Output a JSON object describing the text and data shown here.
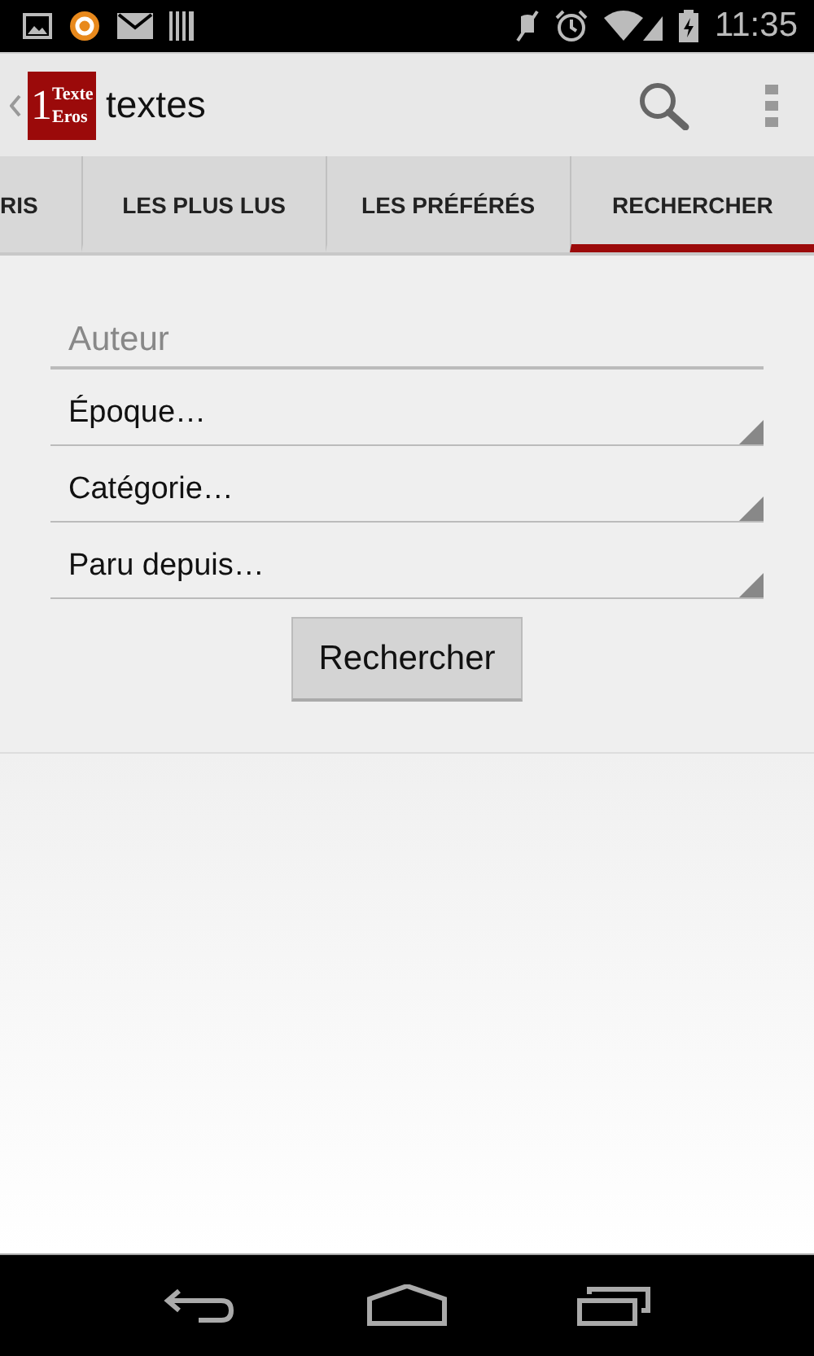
{
  "status_bar": {
    "time": "11:35"
  },
  "action_bar": {
    "logo": {
      "number": "1",
      "line_1": "Texte",
      "line_2": "Eros"
    },
    "title": "textes"
  },
  "tabs": [
    {
      "label": "RIS",
      "selected": false
    },
    {
      "label": "LES PLUS LUS",
      "selected": false
    },
    {
      "label": "LES PRÉFÉRÉS",
      "selected": false
    },
    {
      "label": "RECHERCHER",
      "selected": true
    }
  ],
  "form": {
    "author": {
      "placeholder": "Auteur"
    },
    "dropdowns": [
      {
        "value": "Époque…"
      },
      {
        "value": "Catégorie…"
      },
      {
        "value": "Paru depuis…"
      }
    ],
    "button": "Rechercher"
  }
}
